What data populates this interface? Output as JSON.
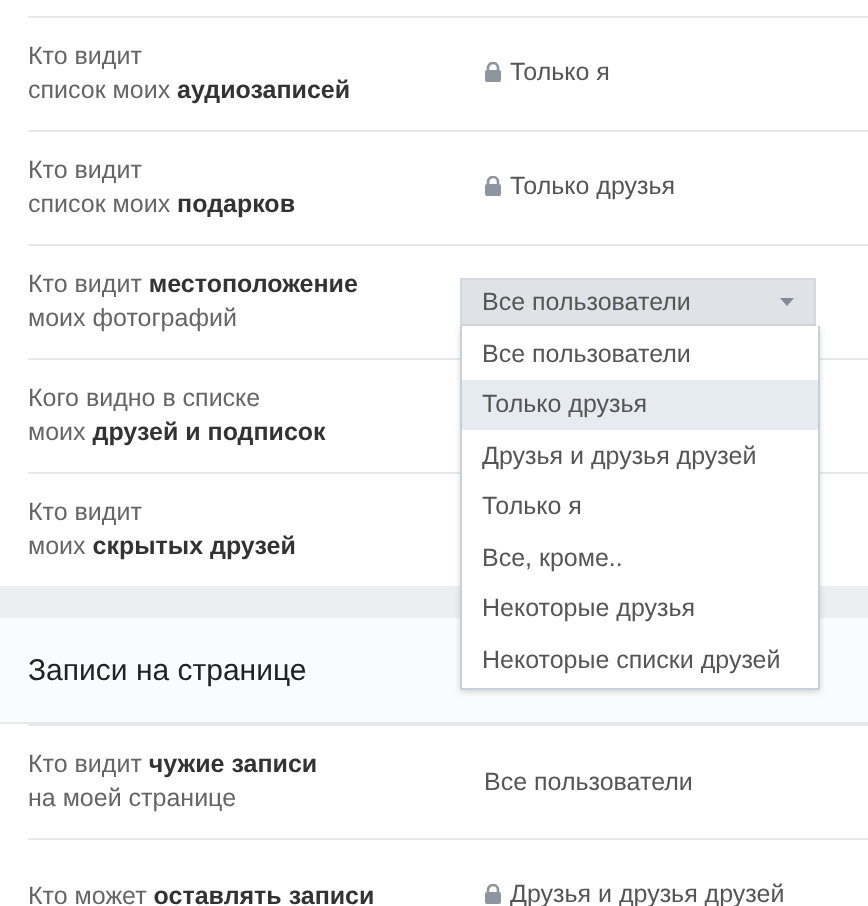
{
  "sections": [
    {
      "rows": [
        {
          "label": [
            "Кто видит",
            "список моих **аудиозаписей**"
          ],
          "value": {
            "kind": "text",
            "text": "Только я",
            "locked": true
          }
        },
        {
          "label": [
            "Кто видит",
            "список моих **подарков**"
          ],
          "value": {
            "kind": "text",
            "text": "Только друзья",
            "locked": true
          }
        },
        {
          "label": [
            "Кто видит **местоположение**",
            "моих фотографий"
          ],
          "value": {
            "kind": "dropdown",
            "text": "Все пользователи",
            "expanded": true,
            "options": [
              {
                "label": "Все пользователи",
                "highlighted": false
              },
              {
                "label": "Только друзья",
                "highlighted": true
              },
              {
                "label": "Друзья и друзья друзей",
                "highlighted": false
              },
              {
                "label": "Только я",
                "highlighted": false
              },
              {
                "label": "Все, кроме..",
                "highlighted": false
              },
              {
                "label": "Некоторые друзья",
                "highlighted": false
              },
              {
                "label": "Некоторые списки друзей",
                "highlighted": false
              }
            ]
          }
        },
        {
          "label": [
            "Кого видно в списке",
            "моих **друзей и подписок**"
          ]
        },
        {
          "label": [
            "Кто видит",
            "моих **скрытых друзей**"
          ]
        }
      ]
    },
    {
      "title": "Записи на странице",
      "rows": [
        {
          "label": [
            "Кто видит **чужие записи**",
            "на моей странице"
          ],
          "value": {
            "kind": "text",
            "text": "Все пользователи",
            "locked": false
          }
        },
        {
          "label": [
            "Кто может **оставлять записи**"
          ],
          "value": {
            "kind": "text",
            "text": "Друзья и друзья друзей",
            "locked": true
          }
        }
      ]
    }
  ]
}
